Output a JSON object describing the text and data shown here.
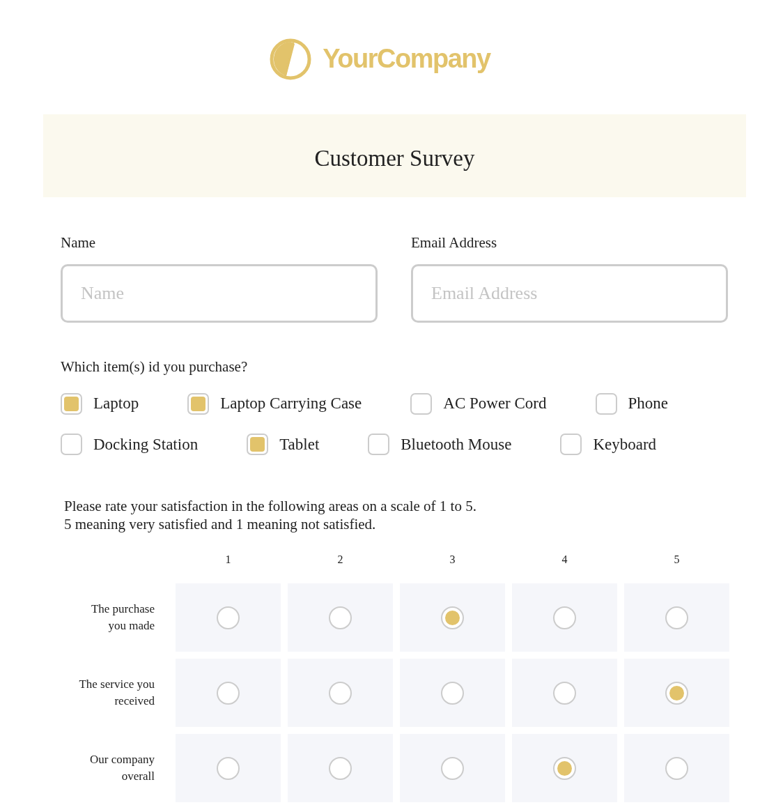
{
  "logo": {
    "text": "YourCompany"
  },
  "title": "Customer Survey",
  "fields": [
    {
      "label": "Name",
      "placeholder": "Name"
    },
    {
      "label": "Email Address",
      "placeholder": "Email Address"
    }
  ],
  "purchase": {
    "question": "Which item(s) id you purchase?",
    "rows": [
      [
        {
          "label": "Laptop",
          "checked": true
        },
        {
          "label": "Laptop Carrying Case",
          "checked": true
        },
        {
          "label": "AC Power Cord",
          "checked": false
        },
        {
          "label": "Phone",
          "checked": false
        }
      ],
      [
        {
          "label": "Docking Station",
          "checked": false
        },
        {
          "label": "Tablet",
          "checked": true
        },
        {
          "label": "Bluetooth Mouse",
          "checked": false
        },
        {
          "label": "Keyboard",
          "checked": false
        }
      ]
    ]
  },
  "rating": {
    "instructions": [
      "Please rate your satisfaction in the following areas on a scale of 1 to 5.",
      "5 meaning very satisfied and 1 meaning not satisfied."
    ],
    "scale": [
      "1",
      "2",
      "3",
      "4",
      "5"
    ],
    "rows": [
      {
        "label": "The purchase you made",
        "options": [
          {
            "selected": false
          },
          {
            "selected": false
          },
          {
            "selected": true
          },
          {
            "selected": false
          },
          {
            "selected": false
          }
        ]
      },
      {
        "label": "The service you received",
        "options": [
          {
            "selected": false
          },
          {
            "selected": false
          },
          {
            "selected": false
          },
          {
            "selected": false
          },
          {
            "selected": true
          }
        ]
      },
      {
        "label": "Our company overall",
        "options": [
          {
            "selected": false
          },
          {
            "selected": false
          },
          {
            "selected": false
          },
          {
            "selected": true
          },
          {
            "selected": false
          }
        ]
      }
    ]
  }
}
